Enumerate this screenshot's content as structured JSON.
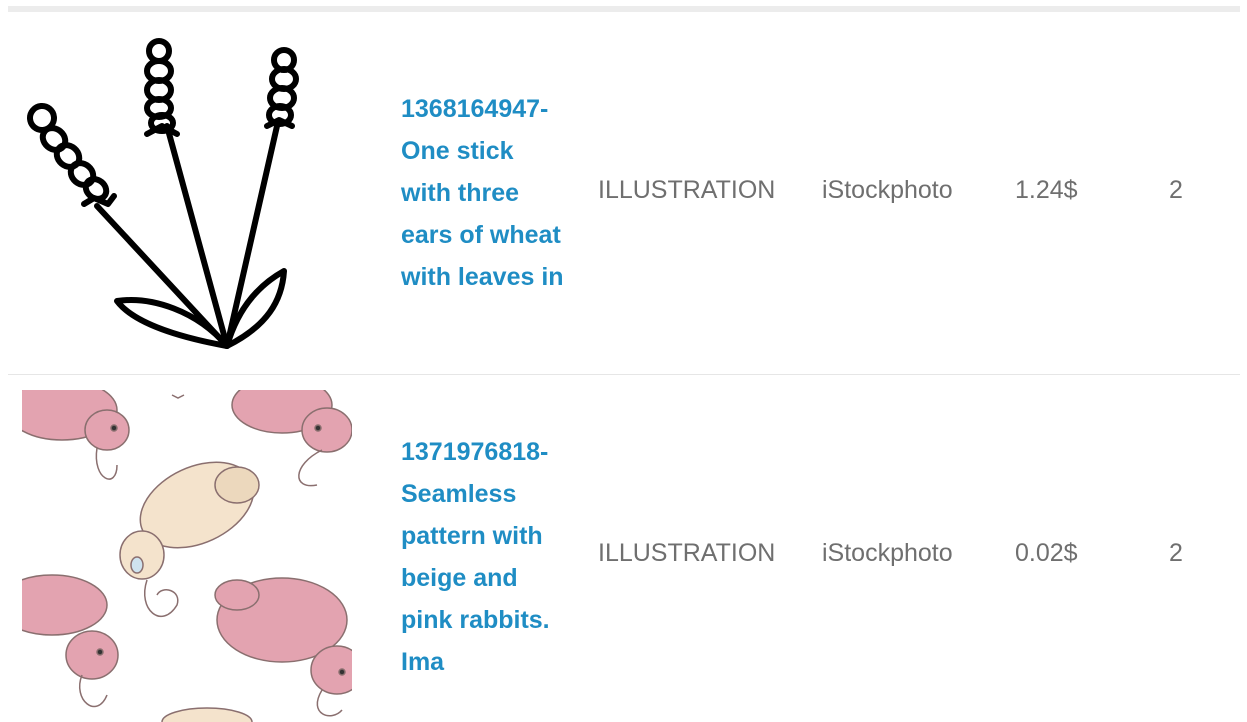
{
  "rows": [
    {
      "title": "1368164947-\nOne stick\nwith three\nears of wheat\nwith leaves in",
      "type": "ILLUSTRATION",
      "source": "iStockphoto",
      "price": "1.24$",
      "count": "2",
      "thumb_icon": "wheat-stick-illustration"
    },
    {
      "title": "1371976818-\nSeamless\npattern with\nbeige and\npink rabbits.\nIma",
      "type": "ILLUSTRATION",
      "source": "iStockphoto",
      "price": "0.02$",
      "count": "2",
      "thumb_icon": "rabbit-pattern-illustration"
    }
  ],
  "colors": {
    "link": "#1f8dc4",
    "text": "#6f6f6f",
    "rabbit_pink": "#e3a3b0",
    "rabbit_beige": "#f4e3cc"
  }
}
